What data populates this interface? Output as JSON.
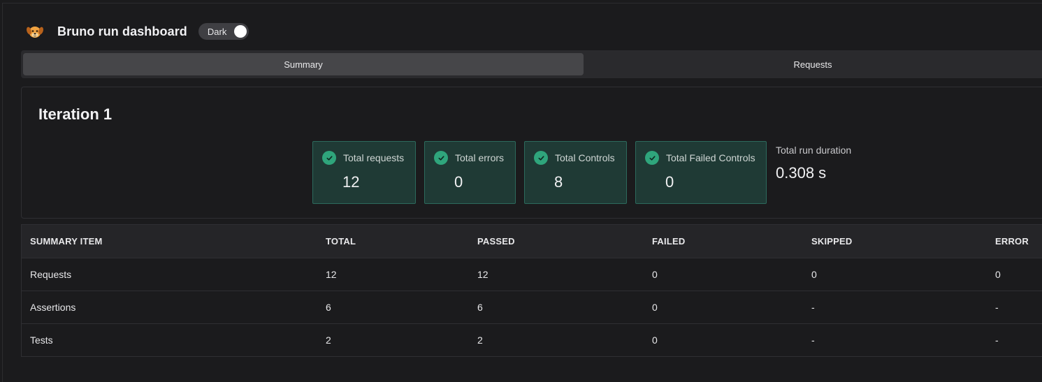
{
  "header": {
    "title": "Bruno run dashboard",
    "theme_toggle_label": "Dark",
    "theme_toggle_on": true,
    "logo_icon": "bruno-dog-icon"
  },
  "tabs": [
    {
      "label": "Summary",
      "active": true
    },
    {
      "label": "Requests",
      "active": false
    }
  ],
  "iteration": {
    "title": "Iteration 1",
    "stats": [
      {
        "label": "Total requests",
        "value": "12",
        "icon": "check-circle-icon"
      },
      {
        "label": "Total errors",
        "value": "0",
        "icon": "check-circle-icon"
      },
      {
        "label": "Total Controls",
        "value": "8",
        "icon": "check-circle-icon"
      },
      {
        "label": "Total Failed Controls",
        "value": "0",
        "icon": "check-circle-icon"
      }
    ],
    "duration": {
      "label": "Total run duration",
      "value": "0.308 s"
    }
  },
  "summary_table": {
    "columns": [
      "SUMMARY ITEM",
      "TOTAL",
      "PASSED",
      "FAILED",
      "SKIPPED",
      "ERROR"
    ],
    "rows": [
      [
        "Requests",
        "12",
        "12",
        "0",
        "0",
        "0"
      ],
      [
        "Assertions",
        "6",
        "6",
        "0",
        "-",
        "-"
      ],
      [
        "Tests",
        "2",
        "2",
        "0",
        "-",
        "-"
      ]
    ]
  },
  "colors": {
    "background": "#1b1b1d",
    "stat_card_bg": "#1f3a35",
    "stat_card_border": "#2c6a5c",
    "success_green": "#2fa57c"
  }
}
